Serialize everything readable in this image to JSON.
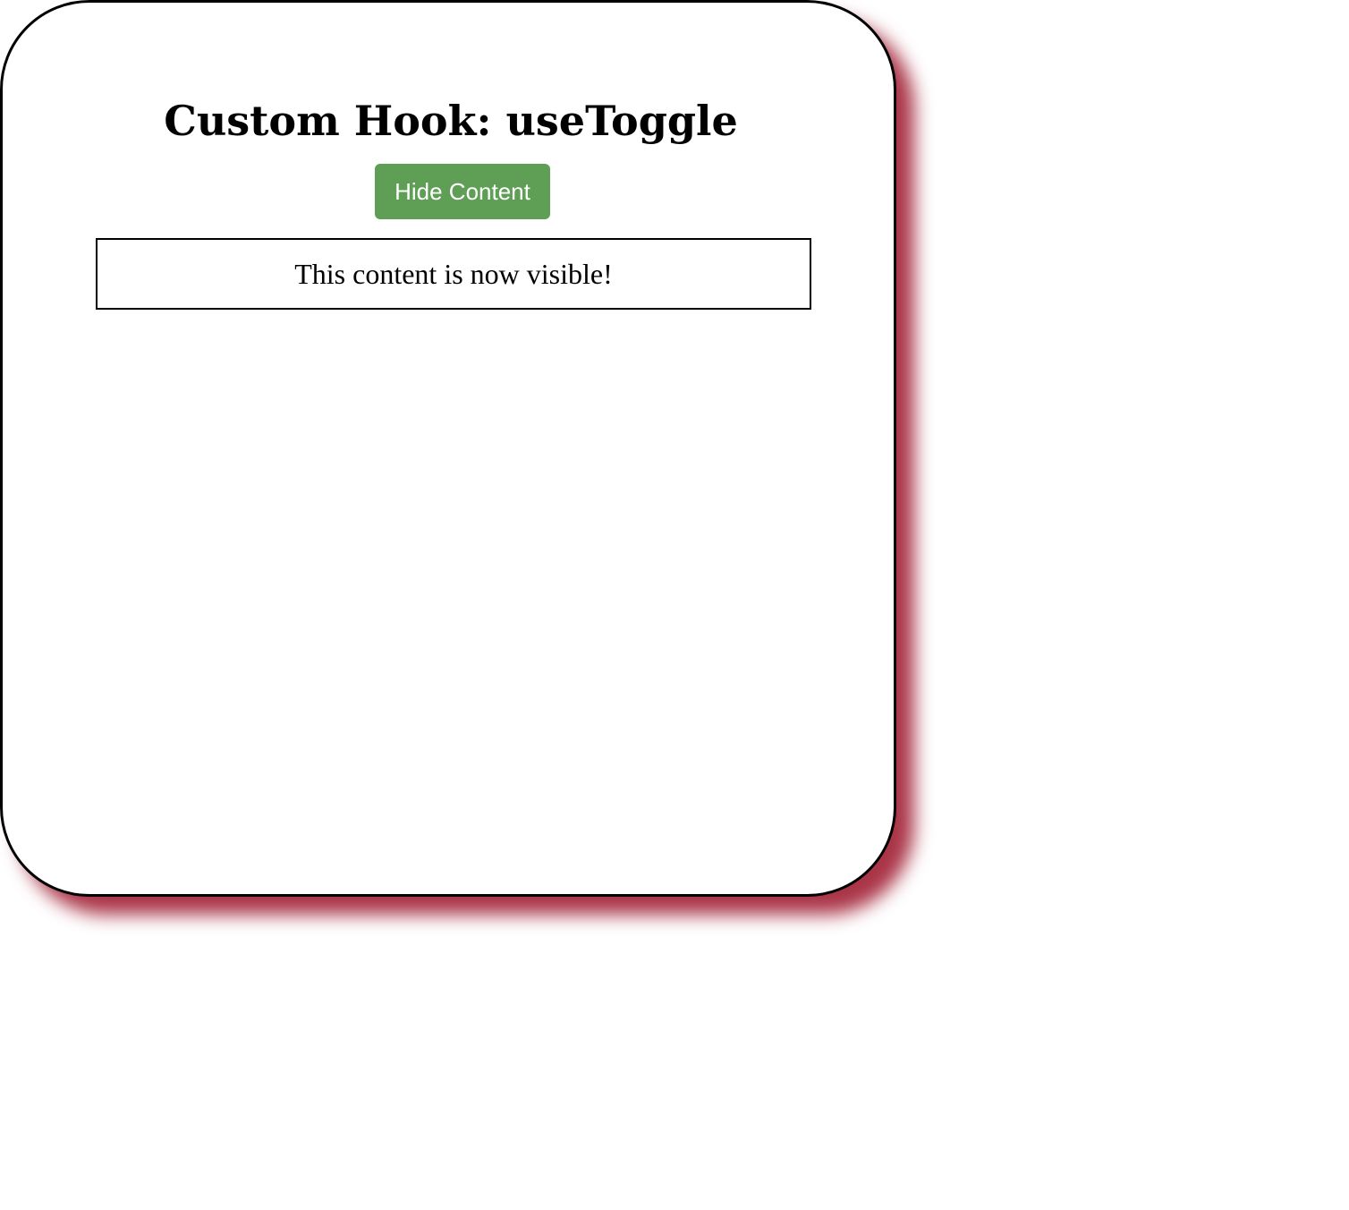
{
  "app": {
    "title": "Custom Hook: useToggle",
    "toggle_button_label": "Hide Content",
    "content_text": "This content is now visible!"
  },
  "colors": {
    "button_bg": "#5f9f55",
    "shadow": "#a52a3e",
    "card_border": "#000000",
    "background": "#ffffff"
  }
}
